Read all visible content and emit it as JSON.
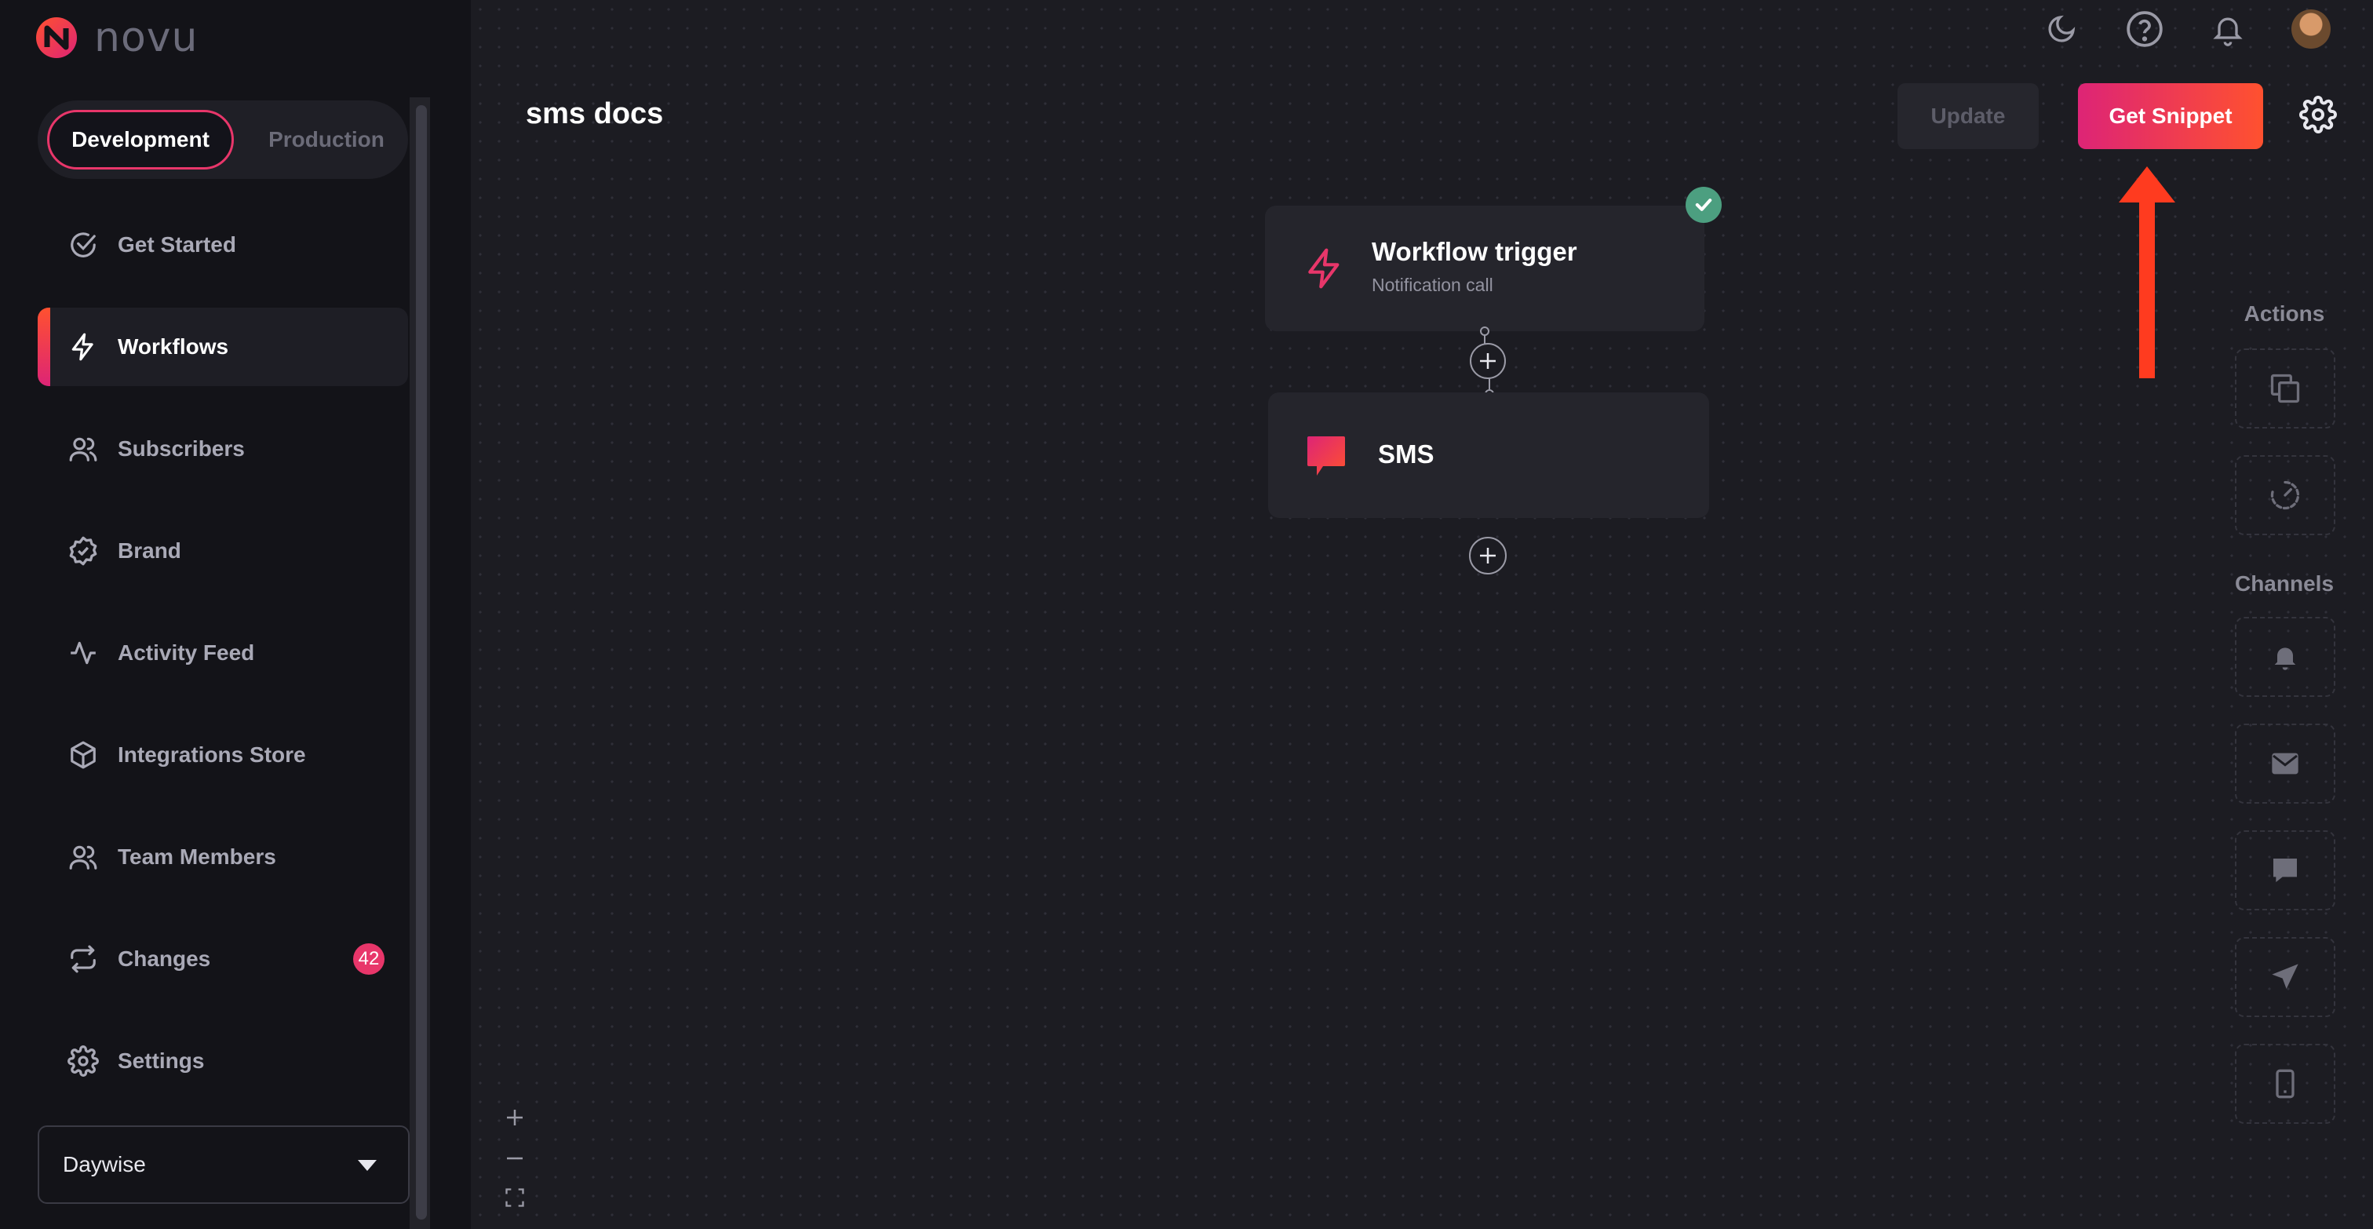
{
  "brand": {
    "logo_text": "novu"
  },
  "environment": {
    "development": "Development",
    "production": "Production",
    "selected": "Development"
  },
  "sidebar": {
    "items": [
      {
        "label": "Get Started",
        "icon": "check-circle-icon"
      },
      {
        "label": "Workflows",
        "icon": "lightning-icon",
        "active": true
      },
      {
        "label": "Subscribers",
        "icon": "users-icon"
      },
      {
        "label": "Brand",
        "icon": "badge-check-icon"
      },
      {
        "label": "Activity Feed",
        "icon": "activity-icon"
      },
      {
        "label": "Integrations Store",
        "icon": "box-icon"
      },
      {
        "label": "Team Members",
        "icon": "team-icon"
      },
      {
        "label": "Changes",
        "icon": "repeat-icon",
        "badge": "42"
      },
      {
        "label": "Settings",
        "icon": "gear-icon"
      }
    ],
    "organization": "Daywise"
  },
  "header": {
    "title": "sms docs",
    "update_label": "Update",
    "snippet_label": "Get Snippet"
  },
  "canvas": {
    "trigger": {
      "title": "Workflow trigger",
      "subtitle": "Notification call"
    },
    "sms": {
      "title": "SMS"
    }
  },
  "panel": {
    "actions_label": "Actions",
    "channels_label": "Channels"
  },
  "colors": {
    "accent_start": "#dd2476",
    "accent_end": "#ff512f",
    "success": "#4c9f80",
    "annotation_arrow": "#ff3b1f"
  }
}
